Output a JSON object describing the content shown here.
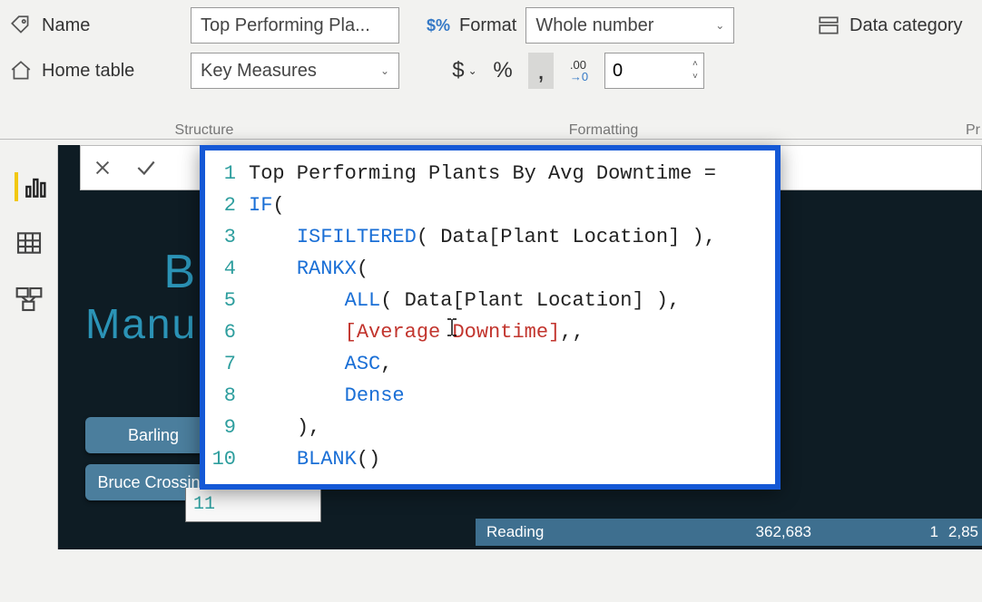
{
  "ribbon": {
    "name_label": "Name",
    "name_value": "Top Performing Pla...",
    "home_table_label": "Home table",
    "home_table_value": "Key Measures",
    "format_label": "Format",
    "format_value": "Whole number",
    "decimals_value": "0",
    "data_category_label": "Data category",
    "group_structure": "Structure",
    "group_formatting": "Formatting",
    "group_properties_partial": "Pr",
    "currency_symbol": "$",
    "percent_symbol": "%",
    "thousands_symbol": ",",
    "decimal_icon_text": ".00"
  },
  "formula": {
    "line_numbers": [
      "1",
      "2",
      "3",
      "4",
      "5",
      "6",
      "7",
      "8",
      "9",
      "10"
    ],
    "extra_line": "11",
    "lines": {
      "l1_a": "Top Performing Plants By Avg Downtime ",
      "l1_b": "=",
      "l2_kw": "IF",
      "l2_rest": "(",
      "l3_kw": "ISFILTERED",
      "l3_rest": "( Data[Plant Location] ),",
      "l4_kw": "RANKX",
      "l4_rest": "(",
      "l5_kw": "ALL",
      "l5_rest": "( Data[Plant Location] ),",
      "l6_measure": "[Average Downtime]",
      "l6_rest": ",,",
      "l7_kw": "ASC",
      "l7_rest": ",",
      "l8_kw": "Dense",
      "l9": "),",
      "l10_kw": "BLANK",
      "l10_rest": "()"
    }
  },
  "report": {
    "bg_title": "Manu",
    "bg_title_pre": "B",
    "slicer_items": [
      "Barling",
      "Bruce Crossing"
    ],
    "table": {
      "location": "Reading",
      "value1": "362,683",
      "value2": "1",
      "value3": "2,85"
    }
  }
}
